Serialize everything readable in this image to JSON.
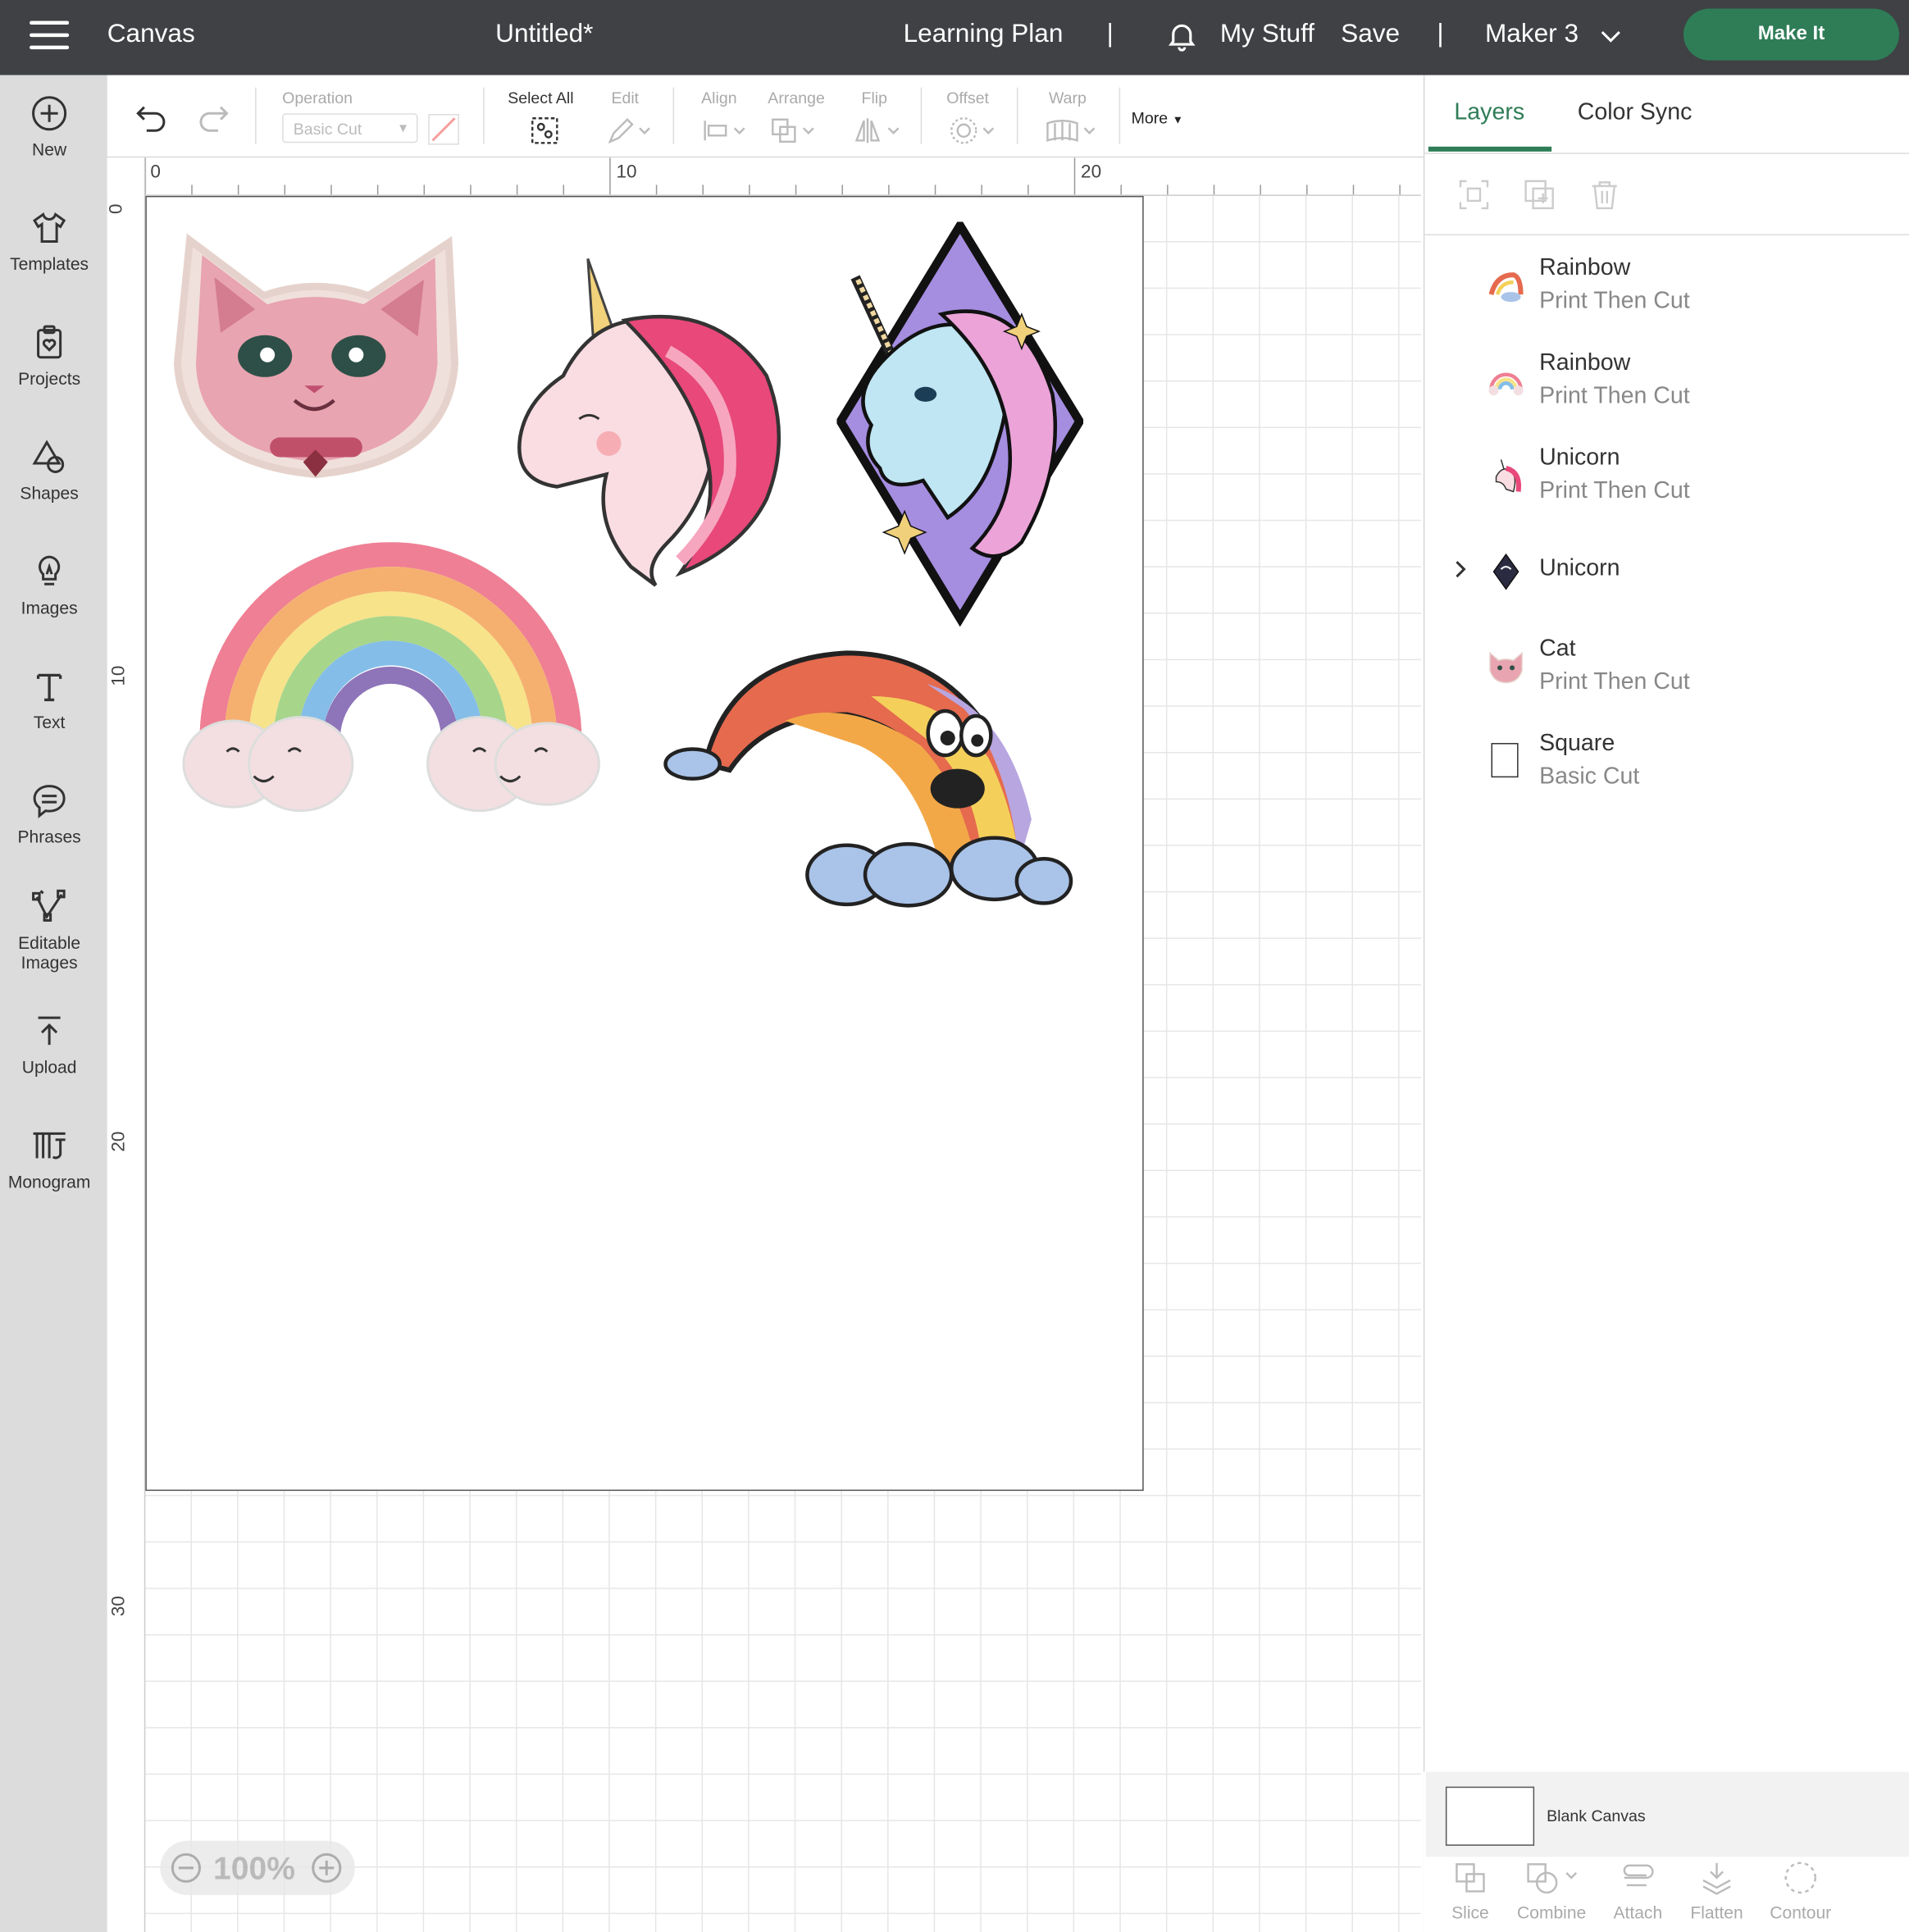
{
  "header": {
    "app_title": "Canvas",
    "doc_title": "Untitled*",
    "learning_plan": "Learning Plan",
    "sep1": "|",
    "my_stuff": "My Stuff",
    "save": "Save",
    "sep2": "|",
    "machine": "Maker 3",
    "make_it": "Make It"
  },
  "sidebar": {
    "items": [
      {
        "label": "New",
        "icon": "plus-circle-icon"
      },
      {
        "label": "Templates",
        "icon": "shirt-icon"
      },
      {
        "label": "Projects",
        "icon": "clipboard-heart-icon"
      },
      {
        "label": "Shapes",
        "icon": "shapes-icon"
      },
      {
        "label": "Images",
        "icon": "lightbulb-icon"
      },
      {
        "label": "Text",
        "icon": "text-icon"
      },
      {
        "label": "Phrases",
        "icon": "speech-bubble-icon"
      },
      {
        "label": "Editable",
        "label2": "Images",
        "icon": "editable-images-icon"
      },
      {
        "label": "Upload",
        "icon": "upload-icon"
      },
      {
        "label": "Monogram",
        "icon": "monogram-icon"
      }
    ]
  },
  "toolbar": {
    "operation_label": "Operation",
    "operation_value": "Basic Cut",
    "select_all": "Select All",
    "edit": "Edit",
    "align": "Align",
    "arrange": "Arrange",
    "flip": "Flip",
    "offset": "Offset",
    "warp": "Warp",
    "more": "More"
  },
  "ruler": {
    "top": [
      "0",
      "10",
      "20"
    ],
    "left": [
      "0",
      "10",
      "20",
      "30"
    ]
  },
  "zoom": {
    "level": "100%"
  },
  "panel": {
    "tabs": [
      "Layers",
      "Color Sync"
    ],
    "active_tab": "Layers",
    "layers": [
      {
        "name": "Rainbow",
        "op": "Print Then Cut",
        "thumb": "rainbow-face-thumb"
      },
      {
        "name": "Rainbow",
        "op": "Print Then Cut",
        "thumb": "rainbow-clouds-thumb"
      },
      {
        "name": "Unicorn",
        "op": "Print Then Cut",
        "thumb": "unicorn-pink-thumb"
      },
      {
        "name": "Unicorn",
        "op": "",
        "thumb": "unicorn-diamond-thumb"
      },
      {
        "name": "Cat",
        "op": "Print Then Cut",
        "thumb": "cat-thumb"
      },
      {
        "name": "Square",
        "op": "Basic Cut",
        "thumb": "square-thumb"
      }
    ],
    "blank_canvas": "Blank Canvas",
    "bottom_actions": [
      "Slice",
      "Combine",
      "Attach",
      "Flatten",
      "Contour"
    ]
  },
  "colors": {
    "header_bg": "#3f4144",
    "accent_green": "#2e7d57",
    "sidebar_bg": "#dcdcdc"
  }
}
